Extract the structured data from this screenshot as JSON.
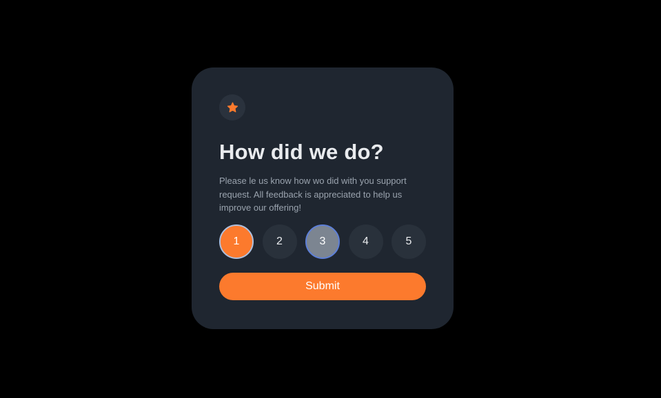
{
  "card": {
    "icon": "star-icon",
    "title": "How did we do?",
    "description": "Please le us know how wo did with you support request. All feedback is appreciated to help us improve our offering!",
    "ratings": [
      {
        "label": "1",
        "state": "selected"
      },
      {
        "label": "2",
        "state": "default"
      },
      {
        "label": "3",
        "state": "hover"
      },
      {
        "label": "4",
        "state": "default"
      },
      {
        "label": "5",
        "state": "default"
      }
    ],
    "submit_label": "Submit"
  },
  "colors": {
    "background": "#000000",
    "card": "#1f2630",
    "accent": "#fc7a2d",
    "rating_default": "#29313b",
    "rating_hover": "#7c8591",
    "text_primary": "#e9ebee",
    "text_secondary": "#9aa3ae"
  }
}
